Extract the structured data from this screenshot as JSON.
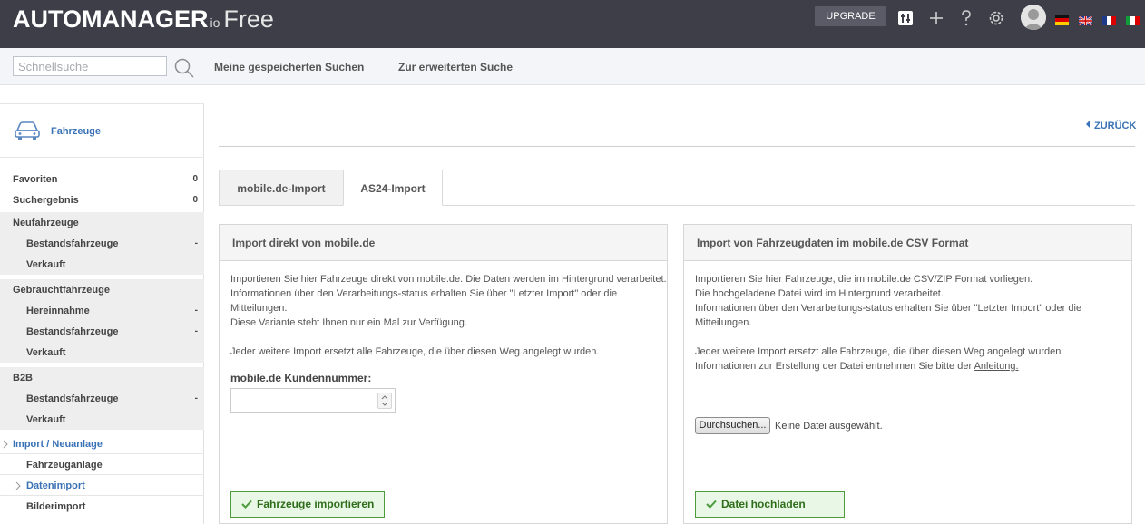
{
  "header": {
    "logo_main": "AUTOMANAGER",
    "logo_io": "io",
    "logo_free": "Free",
    "upgrade_label": "UPGRADE",
    "icons": [
      "sliders-icon",
      "plus-icon",
      "help-icon",
      "gear-icon"
    ],
    "languages": [
      "de",
      "en",
      "fr",
      "it"
    ]
  },
  "search": {
    "placeholder": "Schnellsuche",
    "value": "",
    "saved_searches": "Meine gespeicherten Suchen",
    "advanced_search": "Zur erweiterten Suche"
  },
  "sidebar": {
    "title": "Fahrzeuge",
    "items": [
      {
        "label": "Favoriten",
        "count": "0"
      },
      {
        "label": "Suchergebnis",
        "count": "0"
      },
      {
        "label": "Neufahrzeuge"
      },
      {
        "label": "Bestandsfahrzeuge",
        "count": "-"
      },
      {
        "label": "Verkauft"
      },
      {
        "label": "Gebrauchtfahrzeuge"
      },
      {
        "label": "Hereinnahme",
        "count": "-"
      },
      {
        "label": "Bestandsfahrzeuge",
        "count": "-"
      },
      {
        "label": "Verkauft"
      },
      {
        "label": "B2B"
      },
      {
        "label": "Bestandsfahrzeuge",
        "count": "-"
      },
      {
        "label": "Verkauft"
      },
      {
        "label": "Import / Neuanlage"
      },
      {
        "label": "Fahrzeuganlage"
      },
      {
        "label": "Datenimport"
      },
      {
        "label": "Bilderimport"
      }
    ]
  },
  "main": {
    "back_label": "ZURÜCK",
    "tabs": [
      {
        "label": "mobile.de-Import"
      },
      {
        "label": "AS24-Import"
      }
    ],
    "left_panel": {
      "title": "Import direkt von mobile.de",
      "lines": [
        "Importieren Sie hier Fahrzeuge direkt von mobile.de. Die Daten werden im Hintergrund verarbeitet.",
        "Informationen über den Verarbeitungs-status erhalten Sie über \"Letzter Import\" oder die",
        "Mitteilungen.",
        "Diese Variante steht Ihnen nur ein Mal zur Verfügung.",
        "",
        "Jeder weitere Import ersetzt alle Fahrzeuge, die über diesen Weg angelegt wurden."
      ],
      "field_label": "mobile.de Kundennummer:",
      "field_value": "",
      "button_label": "Fahrzeuge importieren"
    },
    "right_panel": {
      "title": "Import von Fahrzeugdaten im mobile.de CSV Format",
      "lines": [
        "Importieren Sie hier Fahrzeuge, die im mobile.de CSV/ZIP Format vorliegen.",
        "Die hochgeladene Datei wird im Hintergrund verarbeitet.",
        "Informationen über den Verarbeitungs-status erhalten Sie über \"Letzter Import\" oder die",
        "Mitteilungen.",
        "",
        "Jeder weitere Import ersetzt alle Fahrzeuge, die über diesen Weg angelegt wurden."
      ],
      "info_prefix": "Informationen zur Erstellung der Datei entnehmen Sie bitte der ",
      "info_link": "Anleitung.",
      "browse_label": "Durchsuchen...",
      "file_status": "Keine Datei ausgewählt.",
      "button_label": "Datei hochladen"
    }
  }
}
